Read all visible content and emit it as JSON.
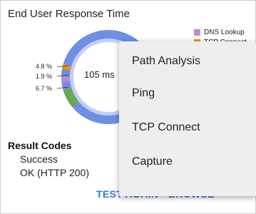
{
  "title": "End User Response Time",
  "chart": {
    "center_value": "105 ms",
    "slices": [
      {
        "pct_label": "4.8 %",
        "color": "#f0930a"
      },
      {
        "pct_label": "1.9 %",
        "color": "#c18ad0"
      },
      {
        "pct_label": "6.7 %",
        "color": "#6aa84f"
      }
    ],
    "ring_color": "#6f8fe6",
    "ring_light": "#c4cef5",
    "legend": [
      {
        "label": "DNS Lookup",
        "color": "#c18ad0"
      },
      {
        "label": "TCP Connect",
        "color": "#f0930a"
      }
    ]
  },
  "result_codes": {
    "title": "Result Codes",
    "line1": "Success",
    "line2": "OK (HTTP 200)"
  },
  "actions": {
    "test_again": "TEST AGAIN",
    "browse": "BROWSE",
    "more": "•••"
  },
  "menu": {
    "items": [
      "Path Analysis",
      "Ping",
      "TCP Connect",
      "Capture"
    ]
  }
}
